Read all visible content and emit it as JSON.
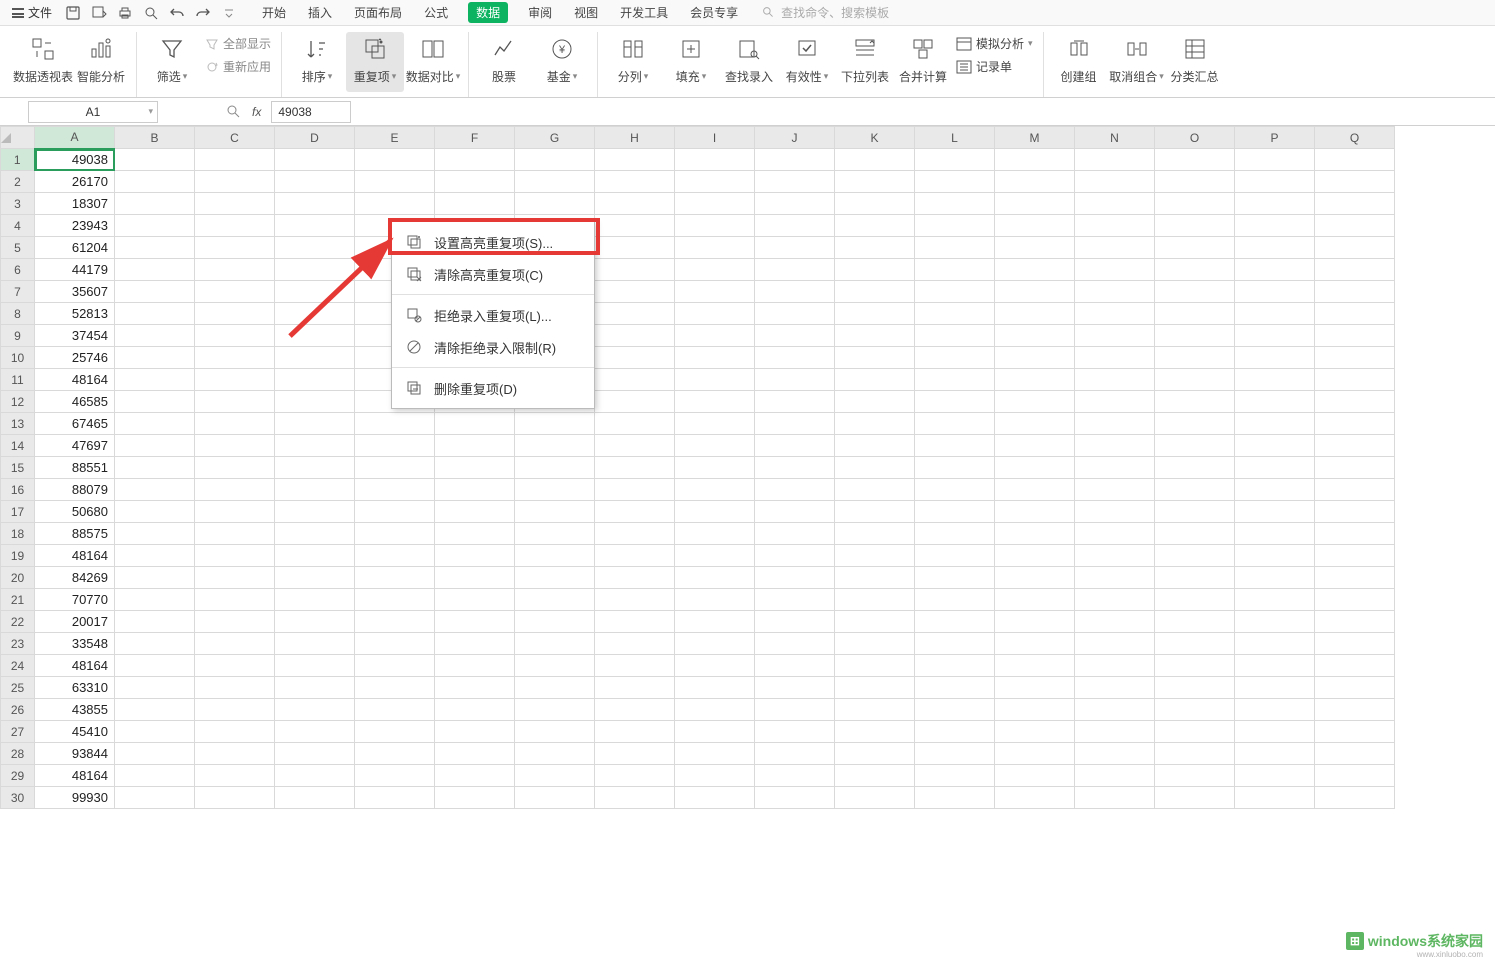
{
  "menubar": {
    "file": "文件",
    "tabs": [
      "开始",
      "插入",
      "页面布局",
      "公式",
      "数据",
      "审阅",
      "视图",
      "开发工具",
      "会员专享"
    ],
    "active_tab_index": 4,
    "search_placeholder": "查找命令、搜索模板"
  },
  "ribbon": {
    "pivot": "数据透视表",
    "smart": "智能分析",
    "filter": "筛选",
    "show_all": "全部显示",
    "reapply": "重新应用",
    "sort": "排序",
    "duplicates": "重复项",
    "compare": "数据对比",
    "stock": "股票",
    "fund": "基金",
    "split": "分列",
    "fill": "填充",
    "lookup": "查找录入",
    "validation": "有效性",
    "dropdown": "下拉列表",
    "consolidate": "合并计算",
    "whatif": "模拟分析",
    "form": "记录单",
    "group": "创建组",
    "ungroup": "取消组合",
    "subtotal": "分类汇总"
  },
  "namebox": {
    "cell_ref": "A1",
    "formula_value": "49038"
  },
  "context_menu": {
    "items": [
      "设置高亮重复项(S)...",
      "清除高亮重复项(C)",
      "拒绝录入重复项(L)...",
      "清除拒绝录入限制(R)",
      "删除重复项(D)"
    ]
  },
  "sheet": {
    "columns": [
      "A",
      "B",
      "C",
      "D",
      "E",
      "F",
      "G",
      "H",
      "I",
      "J",
      "K",
      "L",
      "M",
      "N",
      "O",
      "P",
      "Q"
    ],
    "rows": [
      {
        "n": 1,
        "a": "49038"
      },
      {
        "n": 2,
        "a": "26170"
      },
      {
        "n": 3,
        "a": "18307"
      },
      {
        "n": 4,
        "a": "23943"
      },
      {
        "n": 5,
        "a": "61204"
      },
      {
        "n": 6,
        "a": "44179"
      },
      {
        "n": 7,
        "a": "35607"
      },
      {
        "n": 8,
        "a": "52813"
      },
      {
        "n": 9,
        "a": "37454"
      },
      {
        "n": 10,
        "a": "25746"
      },
      {
        "n": 11,
        "a": "48164"
      },
      {
        "n": 12,
        "a": "46585"
      },
      {
        "n": 13,
        "a": "67465"
      },
      {
        "n": 14,
        "a": "47697"
      },
      {
        "n": 15,
        "a": "88551"
      },
      {
        "n": 16,
        "a": "88079"
      },
      {
        "n": 17,
        "a": "50680"
      },
      {
        "n": 18,
        "a": "88575"
      },
      {
        "n": 19,
        "a": "48164"
      },
      {
        "n": 20,
        "a": "84269"
      },
      {
        "n": 21,
        "a": "70770"
      },
      {
        "n": 22,
        "a": "20017"
      },
      {
        "n": 23,
        "a": "33548"
      },
      {
        "n": 24,
        "a": "48164"
      },
      {
        "n": 25,
        "a": "63310"
      },
      {
        "n": 26,
        "a": "43855"
      },
      {
        "n": 27,
        "a": "45410"
      },
      {
        "n": 28,
        "a": "93844"
      },
      {
        "n": 29,
        "a": "48164"
      },
      {
        "n": 30,
        "a": "99930"
      }
    ]
  },
  "watermark": {
    "text": "windows系统家园",
    "sub": "www.xinluobo.com"
  }
}
